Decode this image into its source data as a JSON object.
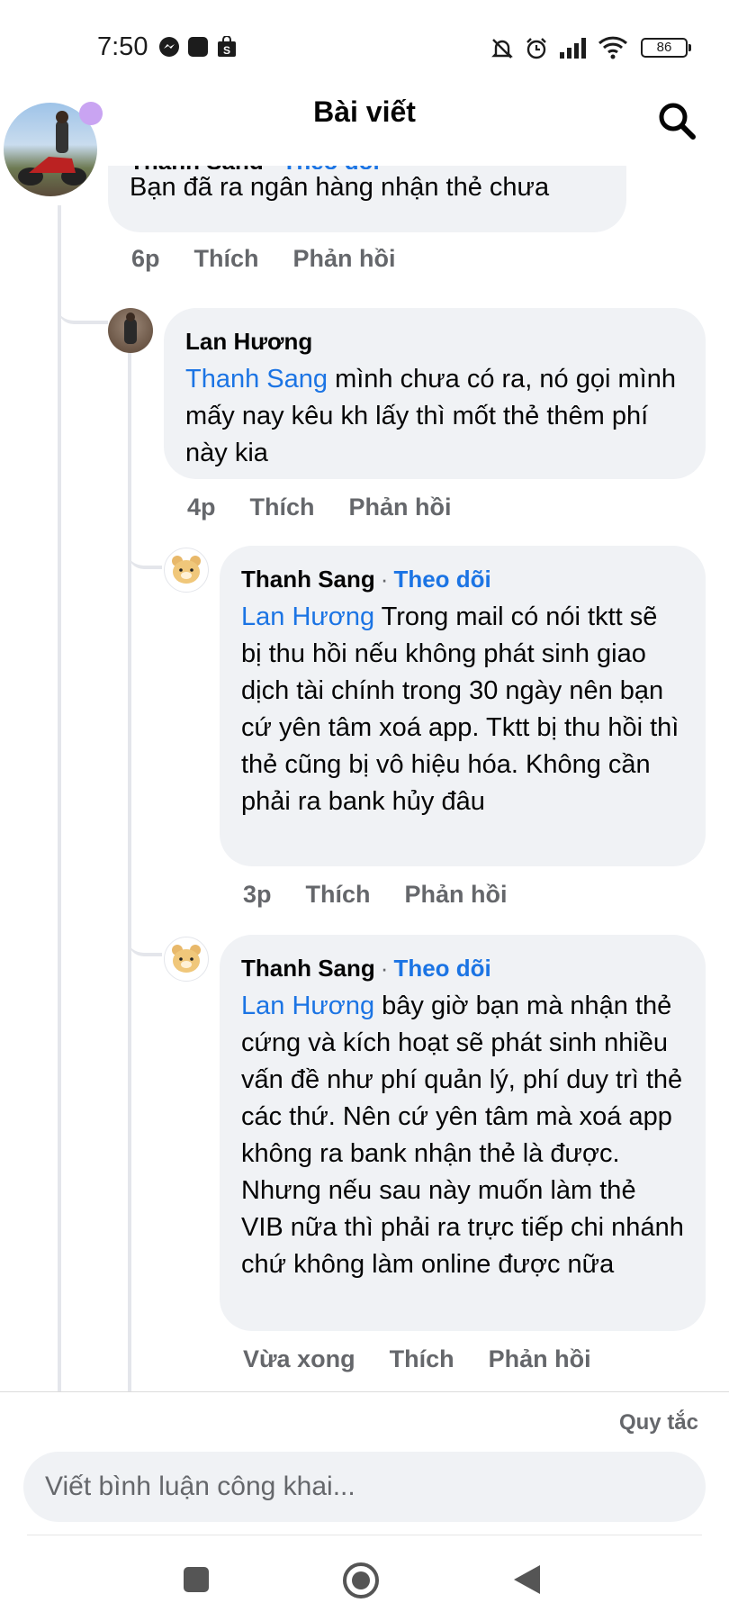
{
  "status_bar": {
    "time": "7:50",
    "battery": "86",
    "icons": [
      "messenger-icon",
      "app-icon",
      "shopping-icon",
      "mute-icon",
      "alarm-icon",
      "signal-icon",
      "wifi-icon",
      "battery-icon"
    ]
  },
  "header": {
    "title": "Bài viết",
    "search_icon": "search-icon"
  },
  "comments": [
    {
      "author": "Thanh Sang",
      "follow": "Theo dõi",
      "separator": "·",
      "text": "Bạn đã ra ngân hàng nhận thẻ chưa",
      "time": "6p",
      "like": "Thích",
      "reply": "Phản hồi"
    },
    {
      "author": "Lan Hương",
      "mention": "Thanh Sang",
      "text": " mình chưa có ra, nó gọi mình mấy nay kêu kh lấy thì mốt thẻ thêm phí này kia",
      "time": "4p",
      "like": "Thích",
      "reply": "Phản hồi"
    },
    {
      "author": "Thanh Sang",
      "follow": "Theo dõi",
      "separator": "·",
      "mention": "Lan Hương",
      "text": " Trong mail có nói tktt sẽ bị thu hồi nếu không phát sinh giao dịch tài chính trong 30 ngày nên bạn cứ yên tâm xoá app. Tktt bị thu hồi thì thẻ cũng bị vô hiệu hóa. Không cần phải ra bank hủy đâu",
      "time": "3p",
      "like": "Thích",
      "reply": "Phản hồi"
    },
    {
      "author": "Thanh Sang",
      "follow": "Theo dõi",
      "separator": "·",
      "mention": "Lan Hương",
      "text": " bây giờ bạn mà nhận thẻ cứng và kích hoạt sẽ phát sinh nhiều vấn đề như phí quản lý, phí duy trì thẻ các thứ. Nên cứ yên tâm mà xoá app không ra bank nhận thẻ là được. Nhưng nếu sau này muốn làm thẻ VIB nữa thì phải ra trực tiếp chi nhánh chứ không làm online được nữa",
      "time": "Vừa xong",
      "like": "Thích",
      "reply": "Phản hồi"
    }
  ],
  "footer": {
    "rules": "Quy tắc",
    "comment_placeholder": "Viết bình luận công khai..."
  },
  "nav": {
    "recents": "square-icon",
    "home": "circle-icon",
    "back": "triangle-back-icon"
  },
  "colors": {
    "accent": "#1b74e4",
    "bubble": "#f0f2f5",
    "meta": "#65676b",
    "thread_line": "#e4e6eb"
  }
}
